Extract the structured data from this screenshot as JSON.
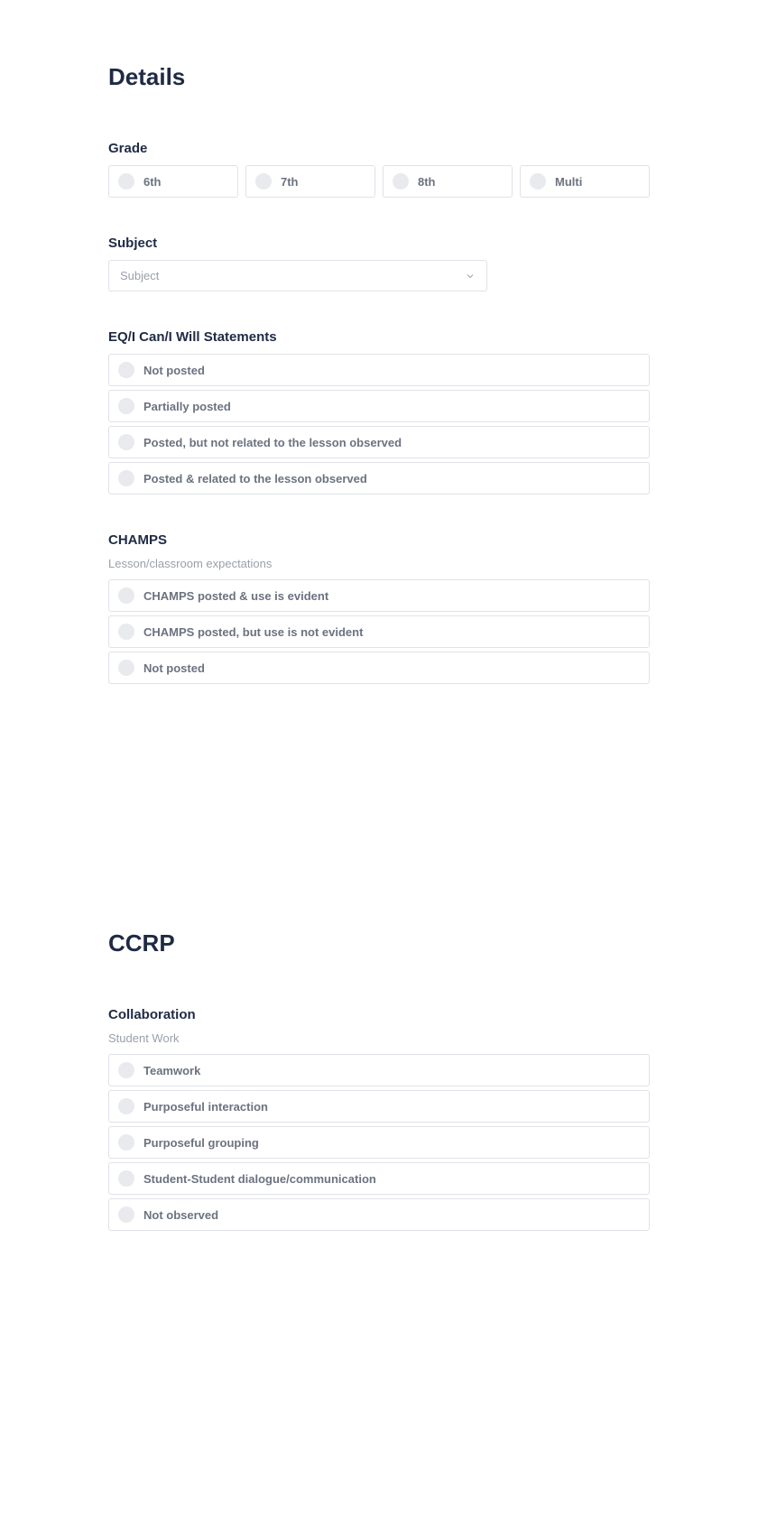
{
  "details": {
    "title": "Details",
    "grade": {
      "label": "Grade",
      "options": [
        "6th",
        "7th",
        "8th",
        "Multi"
      ]
    },
    "subject": {
      "label": "Subject",
      "placeholder": "Subject"
    },
    "eq": {
      "label": "EQ/I Can/I Will Statements",
      "options": [
        "Not posted",
        "Partially posted",
        "Posted, but not related to the lesson observed",
        "Posted & related to the lesson observed"
      ]
    },
    "champs": {
      "label": "CHAMPS",
      "sublabel": "Lesson/classroom expectations",
      "options": [
        "CHAMPS posted & use is evident",
        "CHAMPS posted, but use is not evident",
        "Not posted"
      ]
    }
  },
  "ccrp": {
    "title": "CCRP",
    "collaboration": {
      "label": "Collaboration",
      "sublabel": "Student Work",
      "options": [
        "Teamwork",
        "Purposeful interaction",
        "Purposeful grouping",
        "Student-Student dialogue/communication",
        "Not observed"
      ]
    }
  }
}
